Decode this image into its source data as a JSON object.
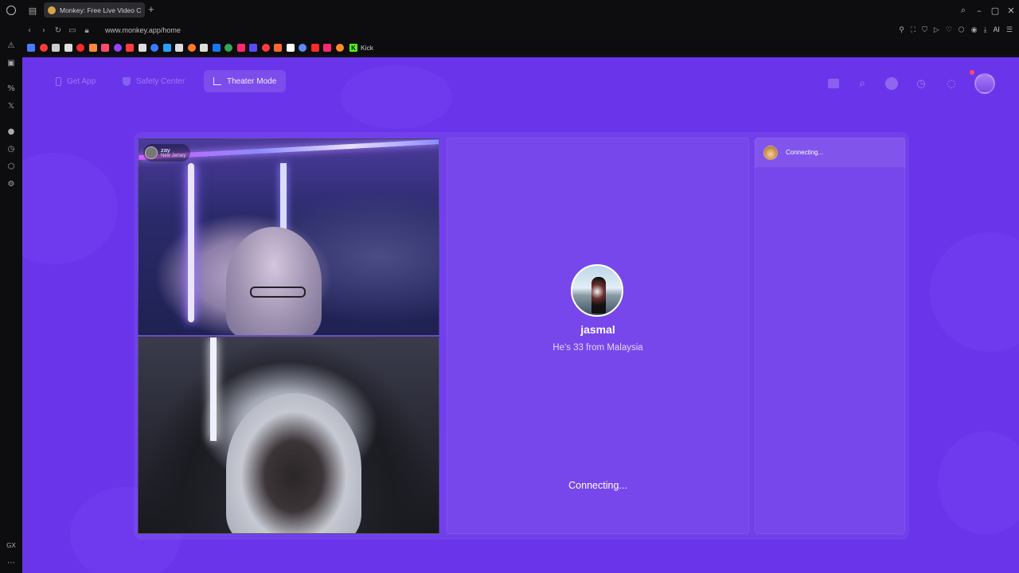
{
  "browser": {
    "tab_title": "Monkey: Free Live Video C",
    "new_tab": "+",
    "url": "www.monkey.app/home",
    "ai_label": "AI",
    "window_controls": [
      "⌕",
      "–",
      "▢",
      "✕"
    ],
    "bookmarks": {
      "colors": [
        "#4a7bff",
        "#ff3b3b",
        "#cccccc",
        "#dddddd",
        "#ff2a2a",
        "#ff8a3d",
        "#ff4a6e",
        "#9146ff",
        "#ff3b3b",
        "#dddddd",
        "#3b7bff",
        "#2aa0ff",
        "#dddddd",
        "#ff7a2a",
        "#dddddd",
        "#1877f2",
        "#34a853",
        "#ff2a6e",
        "#5a4aff",
        "#ff3b3b",
        "#ff6a2a",
        "#ffffff",
        "#5b8cff",
        "#ff2a2a",
        "#ff2a6e",
        "#ff8a2a"
      ],
      "kick_label": "Kick"
    },
    "sidebar_icons": [
      "aria-icon",
      "messenger-icon",
      "percent-icon",
      "x-icon",
      "music-icon",
      "history-icon",
      "extensions-icon",
      "settings-icon",
      "gx-icon",
      "more-icon"
    ]
  },
  "nav": {
    "get_app": "Get App",
    "safety_center": "Safety Center",
    "theater_mode": "Theater Mode"
  },
  "videos": {
    "top_user_name": "zay",
    "top_user_location": "New Jersey"
  },
  "match": {
    "name": "jasmal",
    "info": "He's 33 from Malaysia",
    "status": "Connecting..."
  },
  "side_chat": {
    "status": "Connecting..."
  },
  "colors": {
    "page_bg": "#6a35ea",
    "accent": "#ffffff"
  }
}
